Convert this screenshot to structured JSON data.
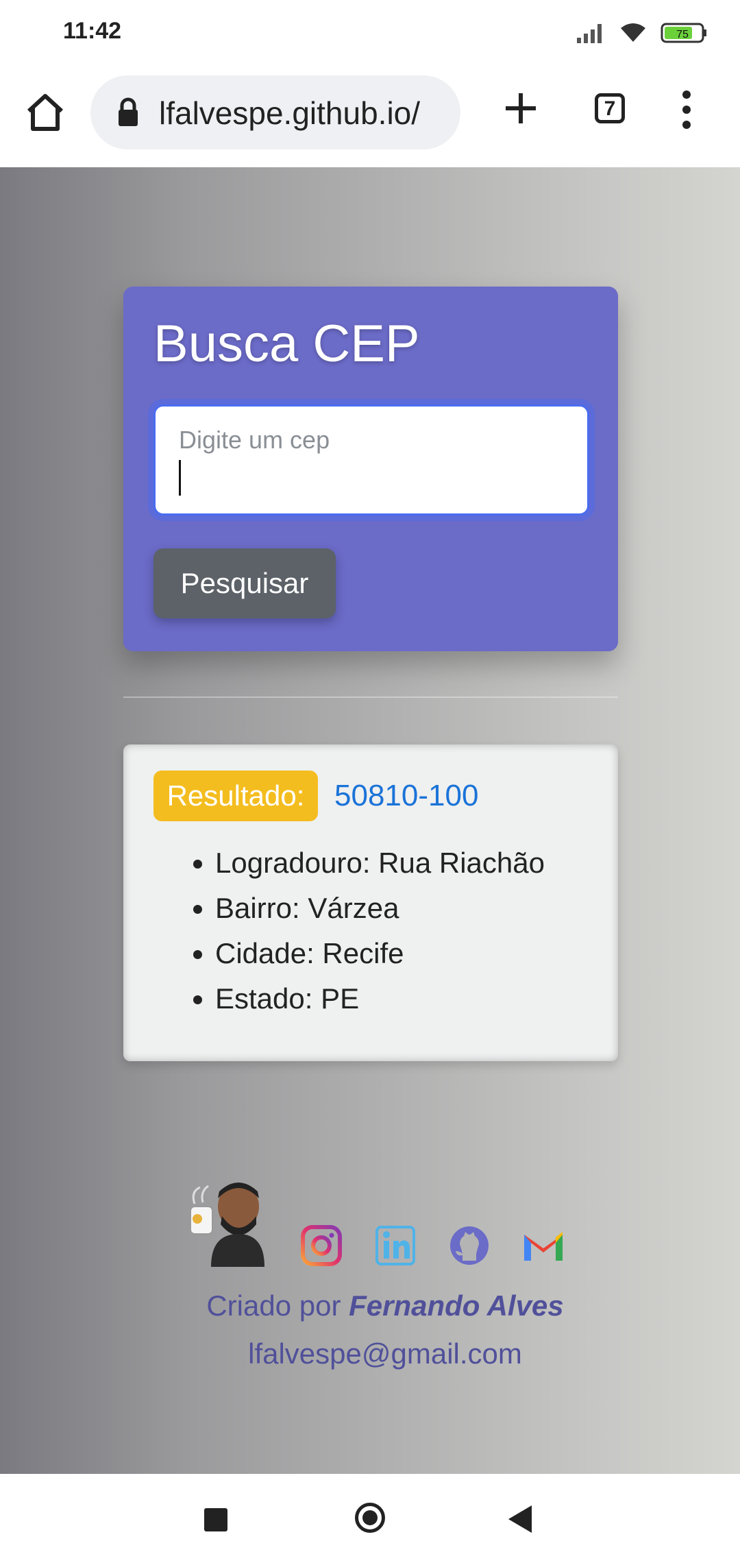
{
  "status_bar": {
    "time": "11:42",
    "battery": "75",
    "icons": [
      "signal-icon",
      "wifi-icon",
      "battery-icon"
    ]
  },
  "browser": {
    "url": "lfalvespe.github.io/",
    "tab_count": "7",
    "icons": [
      "home-icon",
      "lock-icon",
      "plus-icon",
      "tabs-icon",
      "menu-icon"
    ]
  },
  "search_card": {
    "title": "Busca CEP",
    "input_placeholder": "Digite um cep",
    "input_value": "",
    "button_label": "Pesquisar",
    "background_color": "#6b6bc8",
    "button_color": "#5c6268"
  },
  "result": {
    "badge": "Resultado:",
    "cep": "50810-100",
    "items": [
      "Logradouro: Rua Riachão",
      "Bairro: Várzea",
      "Cidade: Recife",
      "Estado: PE"
    ],
    "badge_color": "#f4bd1f",
    "cep_color": "#1a73d8"
  },
  "footer": {
    "created_prefix": "Criado por",
    "author": "Fernando Alves",
    "email": "lfalvespe@gmail.com",
    "social_icons": [
      "instagram-icon",
      "linkedin-icon",
      "github-icon",
      "gmail-icon"
    ]
  },
  "nav_bar": {
    "icons": [
      "recents-icon",
      "home-circle-icon",
      "back-icon"
    ]
  }
}
